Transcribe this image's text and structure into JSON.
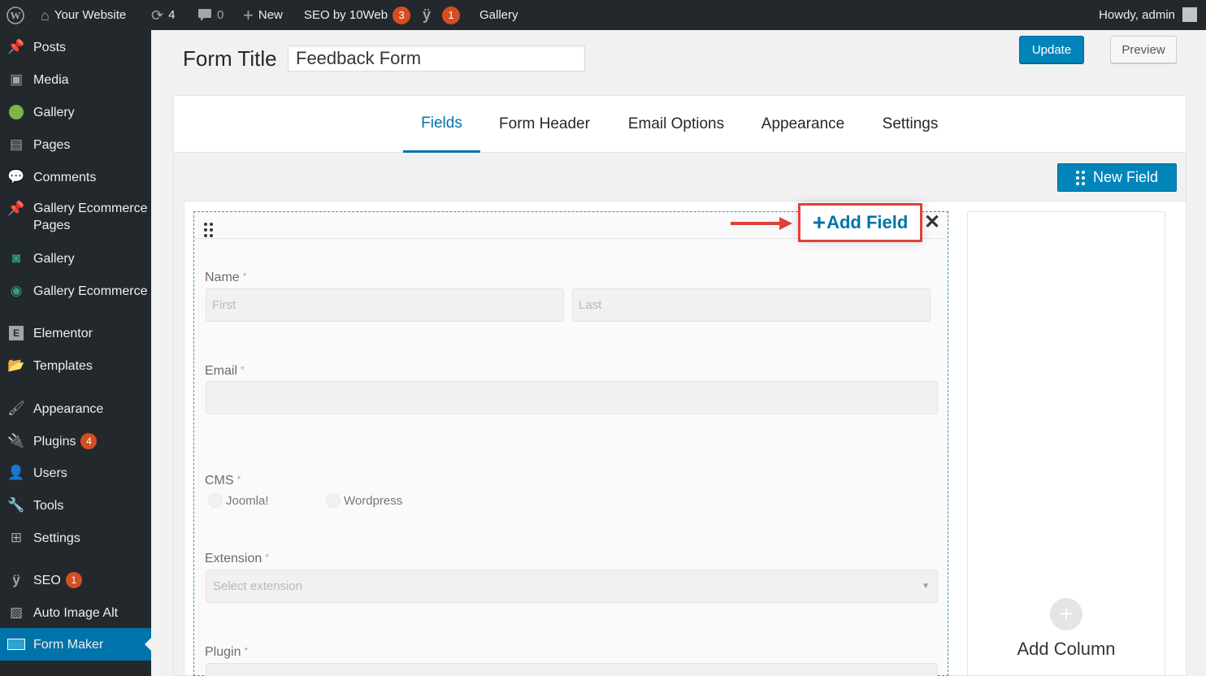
{
  "admin_bar": {
    "site_name": "Your Website",
    "updates_count": "4",
    "comments_count": "0",
    "new_label": "New",
    "seo_label": "SEO by 10Web",
    "seo_badge": "3",
    "yoast_badge": "1",
    "gallery_label": "Gallery",
    "howdy": "Howdy, admin"
  },
  "sidebar": {
    "items": [
      {
        "label": "Posts",
        "icon": "pin-icon"
      },
      {
        "label": "Media",
        "icon": "media-icon"
      },
      {
        "label": "Gallery",
        "icon": "gallery-icon"
      },
      {
        "label": "Pages",
        "icon": "pages-icon"
      },
      {
        "label": "Comments",
        "icon": "comment-icon"
      },
      {
        "label": "Gallery Ecommerce",
        "label2": "Pages",
        "icon": "pin-icon"
      },
      {
        "label": "Gallery",
        "icon": "camera-icon"
      },
      {
        "label": "Gallery Ecommerce",
        "icon": "eye-icon"
      },
      {
        "label": "Elementor",
        "icon": "elementor-icon"
      },
      {
        "label": "Templates",
        "icon": "folder-icon"
      },
      {
        "label": "Appearance",
        "icon": "brush-icon"
      },
      {
        "label": "Plugins",
        "icon": "plugin-icon",
        "badge": "4"
      },
      {
        "label": "Users",
        "icon": "user-icon"
      },
      {
        "label": "Tools",
        "icon": "wrench-icon"
      },
      {
        "label": "Settings",
        "icon": "settings-icon"
      },
      {
        "label": "SEO",
        "icon": "yoast-icon",
        "badge": "1"
      },
      {
        "label": "Auto Image Alt",
        "icon": "image-alt-icon"
      },
      {
        "label": "Form Maker",
        "icon": "form-maker-icon"
      }
    ]
  },
  "header": {
    "form_title_label": "Form Title",
    "form_title_value": "Feedback Form",
    "update_label": "Update",
    "preview_label": "Preview"
  },
  "tabs": [
    "Fields",
    "Form Header",
    "Email Options",
    "Appearance",
    "Settings"
  ],
  "toolbar": {
    "new_field_label": "New Field"
  },
  "column": {
    "add_field_label": "Add Field",
    "fields": {
      "name_label": "Name",
      "first_placeholder": "First",
      "last_placeholder": "Last",
      "email_label": "Email",
      "cms_label": "CMS",
      "cms_options": [
        "Joomla!",
        "Wordpress"
      ],
      "extension_label": "Extension",
      "extension_placeholder": "Select extension",
      "plugin_label": "Plugin"
    },
    "required_mark": "*"
  },
  "add_column": {
    "label": "Add Column"
  },
  "colors": {
    "accent": "#0073aa",
    "button": "#0085ba",
    "highlight": "#e0413a",
    "admin_bg": "#23282d"
  }
}
